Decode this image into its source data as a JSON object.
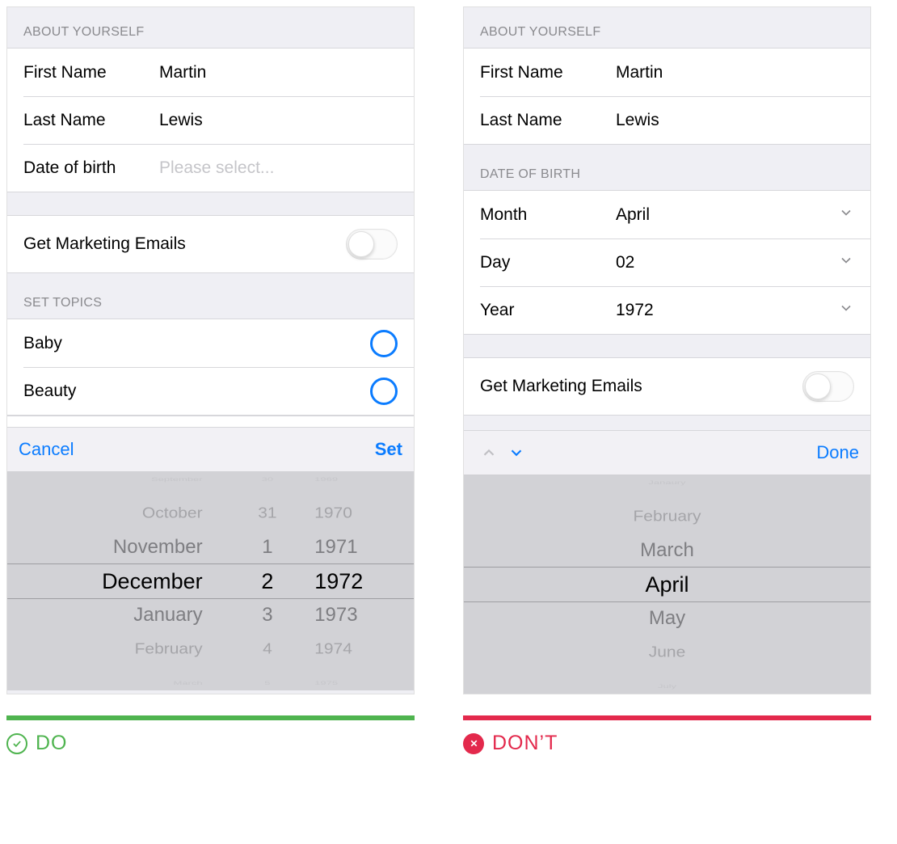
{
  "colors": {
    "accent_blue": "#0b7cff",
    "do_green": "#4fb44f",
    "dont_red": "#e3294c"
  },
  "left": {
    "section_about": "ABOUT YOURSELF",
    "first_name_label": "First Name",
    "first_name_value": "Martin",
    "last_name_label": "Last Name",
    "last_name_value": "Lewis",
    "dob_label": "Date of birth",
    "dob_placeholder": "Please select...",
    "marketing_label": "Get Marketing Emails",
    "marketing_on": false,
    "section_topics": "SET TOPICS",
    "topics": [
      {
        "label": "Baby",
        "selected": false
      },
      {
        "label": "Beauty",
        "selected": false
      }
    ],
    "picker_toolbar": {
      "cancel": "Cancel",
      "set": "Set"
    },
    "picker": {
      "months": [
        "September",
        "October",
        "November",
        "December",
        "January",
        "February",
        "March"
      ],
      "days": [
        "30",
        "31",
        "1",
        "2",
        "3",
        "4",
        "5"
      ],
      "years": [
        "1969",
        "1970",
        "1971",
        "1972",
        "1973",
        "1974",
        "1975"
      ],
      "selected_index": 3
    }
  },
  "right": {
    "section_about": "ABOUT YOURSELF",
    "first_name_label": "First Name",
    "first_name_value": "Martin",
    "last_name_label": "Last Name",
    "last_name_value": "Lewis",
    "section_dob": "DATE OF BIRTH",
    "month_label": "Month",
    "month_value": "April",
    "day_label": "Day",
    "day_value": "02",
    "year_label": "Year",
    "year_value": "1972",
    "marketing_label": "Get Marketing Emails",
    "marketing_on": false,
    "picker_toolbar": {
      "done": "Done"
    },
    "picker": {
      "items": [
        "Janaury",
        "February",
        "March",
        "April",
        "May",
        "June",
        "July"
      ],
      "selected_index": 3
    }
  },
  "captions": {
    "do": "DO",
    "dont": "DON’T"
  }
}
